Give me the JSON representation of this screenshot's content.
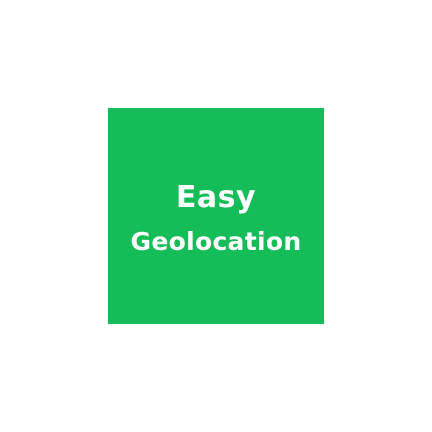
{
  "logo": {
    "line1": "Easy",
    "line2": "Geolocation",
    "background_color": "#15bd59",
    "text_color": "#ffffff"
  }
}
